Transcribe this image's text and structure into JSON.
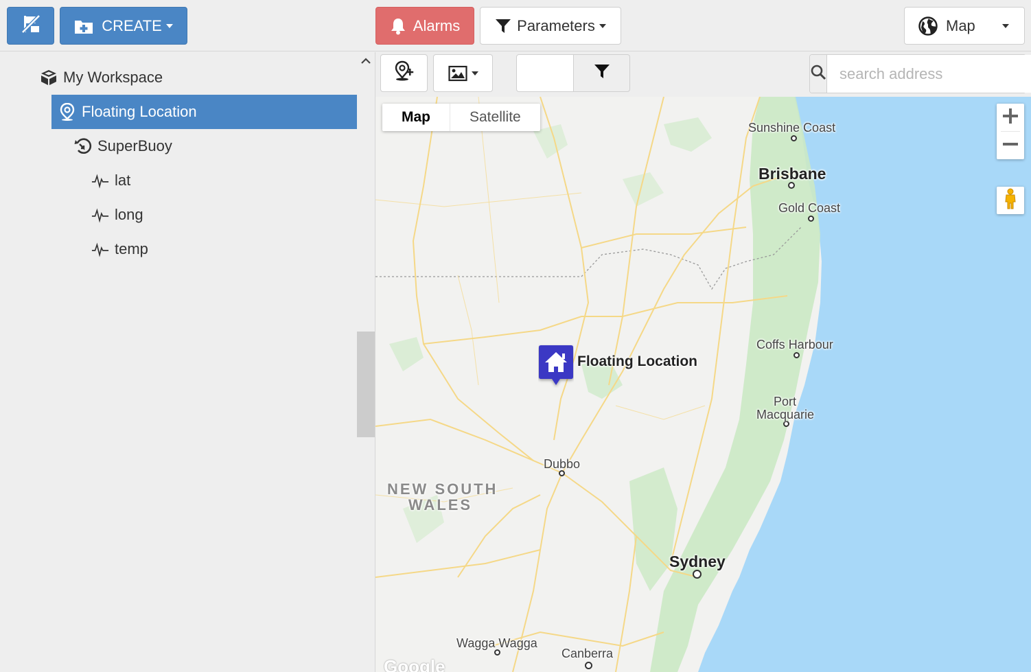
{
  "topbar": {
    "create_label": "CREATE",
    "alarms_label": "Alarms",
    "parameters_label": "Parameters",
    "view_label": "Map"
  },
  "sidebar": {
    "tree": [
      {
        "label": "My Workspace",
        "icon": "boxes-icon",
        "level": 0
      },
      {
        "label": "Floating Location",
        "icon": "map-pin-icon",
        "level": 1,
        "selected": true
      },
      {
        "label": "SuperBuoy",
        "icon": "device-icon",
        "level": 2
      },
      {
        "label": "lat",
        "icon": "pulse-icon",
        "level": 3
      },
      {
        "label": "long",
        "icon": "pulse-icon",
        "level": 3
      },
      {
        "label": "temp",
        "icon": "pulse-icon",
        "level": 3
      }
    ]
  },
  "mapbar": {
    "search_placeholder": "search address"
  },
  "map": {
    "type_map": "Map",
    "type_satellite": "Satellite",
    "marker_label": "Floating Location",
    "state_label_line1": "NEW SOUTH",
    "state_label_line2": "WALES",
    "cities": {
      "sunshine_coast": "Sunshine Coast",
      "brisbane": "Brisbane",
      "gold_coast": "Gold Coast",
      "coffs_harbour": "Coffs Harbour",
      "port_macquarie_1": "Port",
      "port_macquarie_2": "Macquarie",
      "dubbo": "Dubbo",
      "sydney": "Sydney",
      "wagga_wagga": "Wagga Wagga",
      "canberra": "Canberra"
    },
    "attribution": "Google",
    "colors": {
      "ocean": "#a8d8f8",
      "land": "#f2f2f0",
      "forest": "#cbe9c4",
      "road": "#f5d887",
      "marker": "#3a37c4"
    }
  },
  "colors": {
    "primary": "#4a86c5",
    "alarm": "#e06d6d",
    "background": "#eeeeee"
  }
}
